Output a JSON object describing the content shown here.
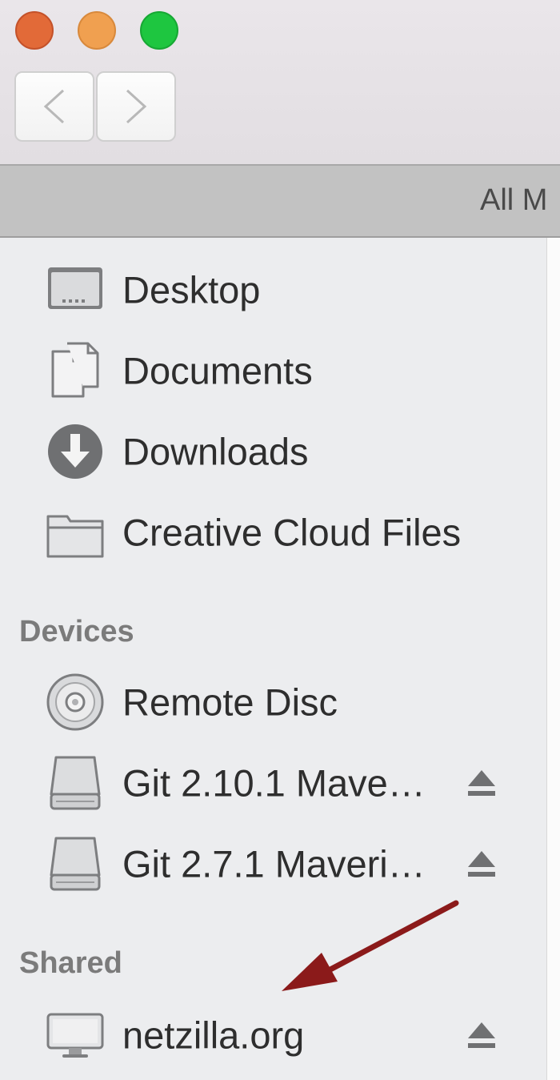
{
  "window": {
    "traffic_lights": {
      "close_color": "#e26a38",
      "minimize_color": "#f0a050",
      "zoom_color": "#1ec640"
    }
  },
  "toolbar": {
    "back_icon": "chevron-left-icon",
    "forward_icon": "chevron-right-icon"
  },
  "tab": {
    "label": "All M"
  },
  "sidebar": {
    "favorites": [
      {
        "label": "Desktop",
        "icon": "desktop-icon"
      },
      {
        "label": "Documents",
        "icon": "documents-icon"
      },
      {
        "label": "Downloads",
        "icon": "downloads-icon"
      },
      {
        "label": "Creative Cloud Files",
        "icon": "folder-icon"
      }
    ],
    "devices_header": "Devices",
    "devices": [
      {
        "label": "Remote Disc",
        "icon": "disc-icon",
        "eject": false
      },
      {
        "label": "Git 2.10.1 Mave…",
        "icon": "drive-icon",
        "eject": true
      },
      {
        "label": "Git 2.7.1 Maveri…",
        "icon": "drive-icon",
        "eject": true
      }
    ],
    "shared_header": "Shared",
    "shared": [
      {
        "label": "netzilla.org",
        "icon": "monitor-icon",
        "eject": true
      }
    ]
  },
  "annotation": {
    "arrow_color": "#8b1a1a"
  }
}
